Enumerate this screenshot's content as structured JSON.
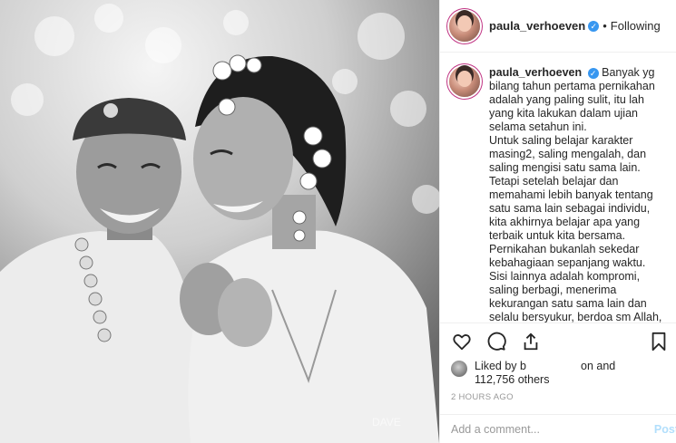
{
  "post": {
    "username": "paula_verhoeven",
    "separator": "•",
    "follow_status": "Following"
  },
  "caption": {
    "username": "paula_verhoeven",
    "paragraphs": [
      "Banyak yg bilang tahun pertama pernikahan adalah yang paling sulit, itu lah yang kita lakukan dalam ujian selama setahun ini.",
      "Untuk saling belajar karakter masing2, saling mengalah, dan saling mengisi satu sama lain. Tetapi setelah belajar dan memahami lebih banyak tentang satu sama lain sebagai individu, kita akhirnya belajar apa yang terbaik untuk kita bersama.",
      "Pernikahan bukanlah sekedar kebahagiaan sepanjang waktu. Sisi lainnya adalah kompromi, saling berbagi, menerima kekurangan satu sama lain dan selalu bersyukur, berdoa sm Allah, pasti Allah akan selalu melindungi dan menjaga kita"
    ]
  },
  "actions": {
    "icons": [
      "heart-icon",
      "comment-icon",
      "share-icon",
      "bookmark-icon"
    ]
  },
  "likes": {
    "prefix": "Liked by",
    "name_start": "b",
    "name_end": "on",
    "connector": "and",
    "count": "112,756 others"
  },
  "timestamp": "2 HOURS AGO",
  "comment": {
    "placeholder": "Add a comment...",
    "post_label": "Post"
  },
  "colors": {
    "text": "#262626",
    "muted": "#999999",
    "verified": "#3897f0",
    "border": "#efefef",
    "post_disabled": "#b2dffc"
  }
}
